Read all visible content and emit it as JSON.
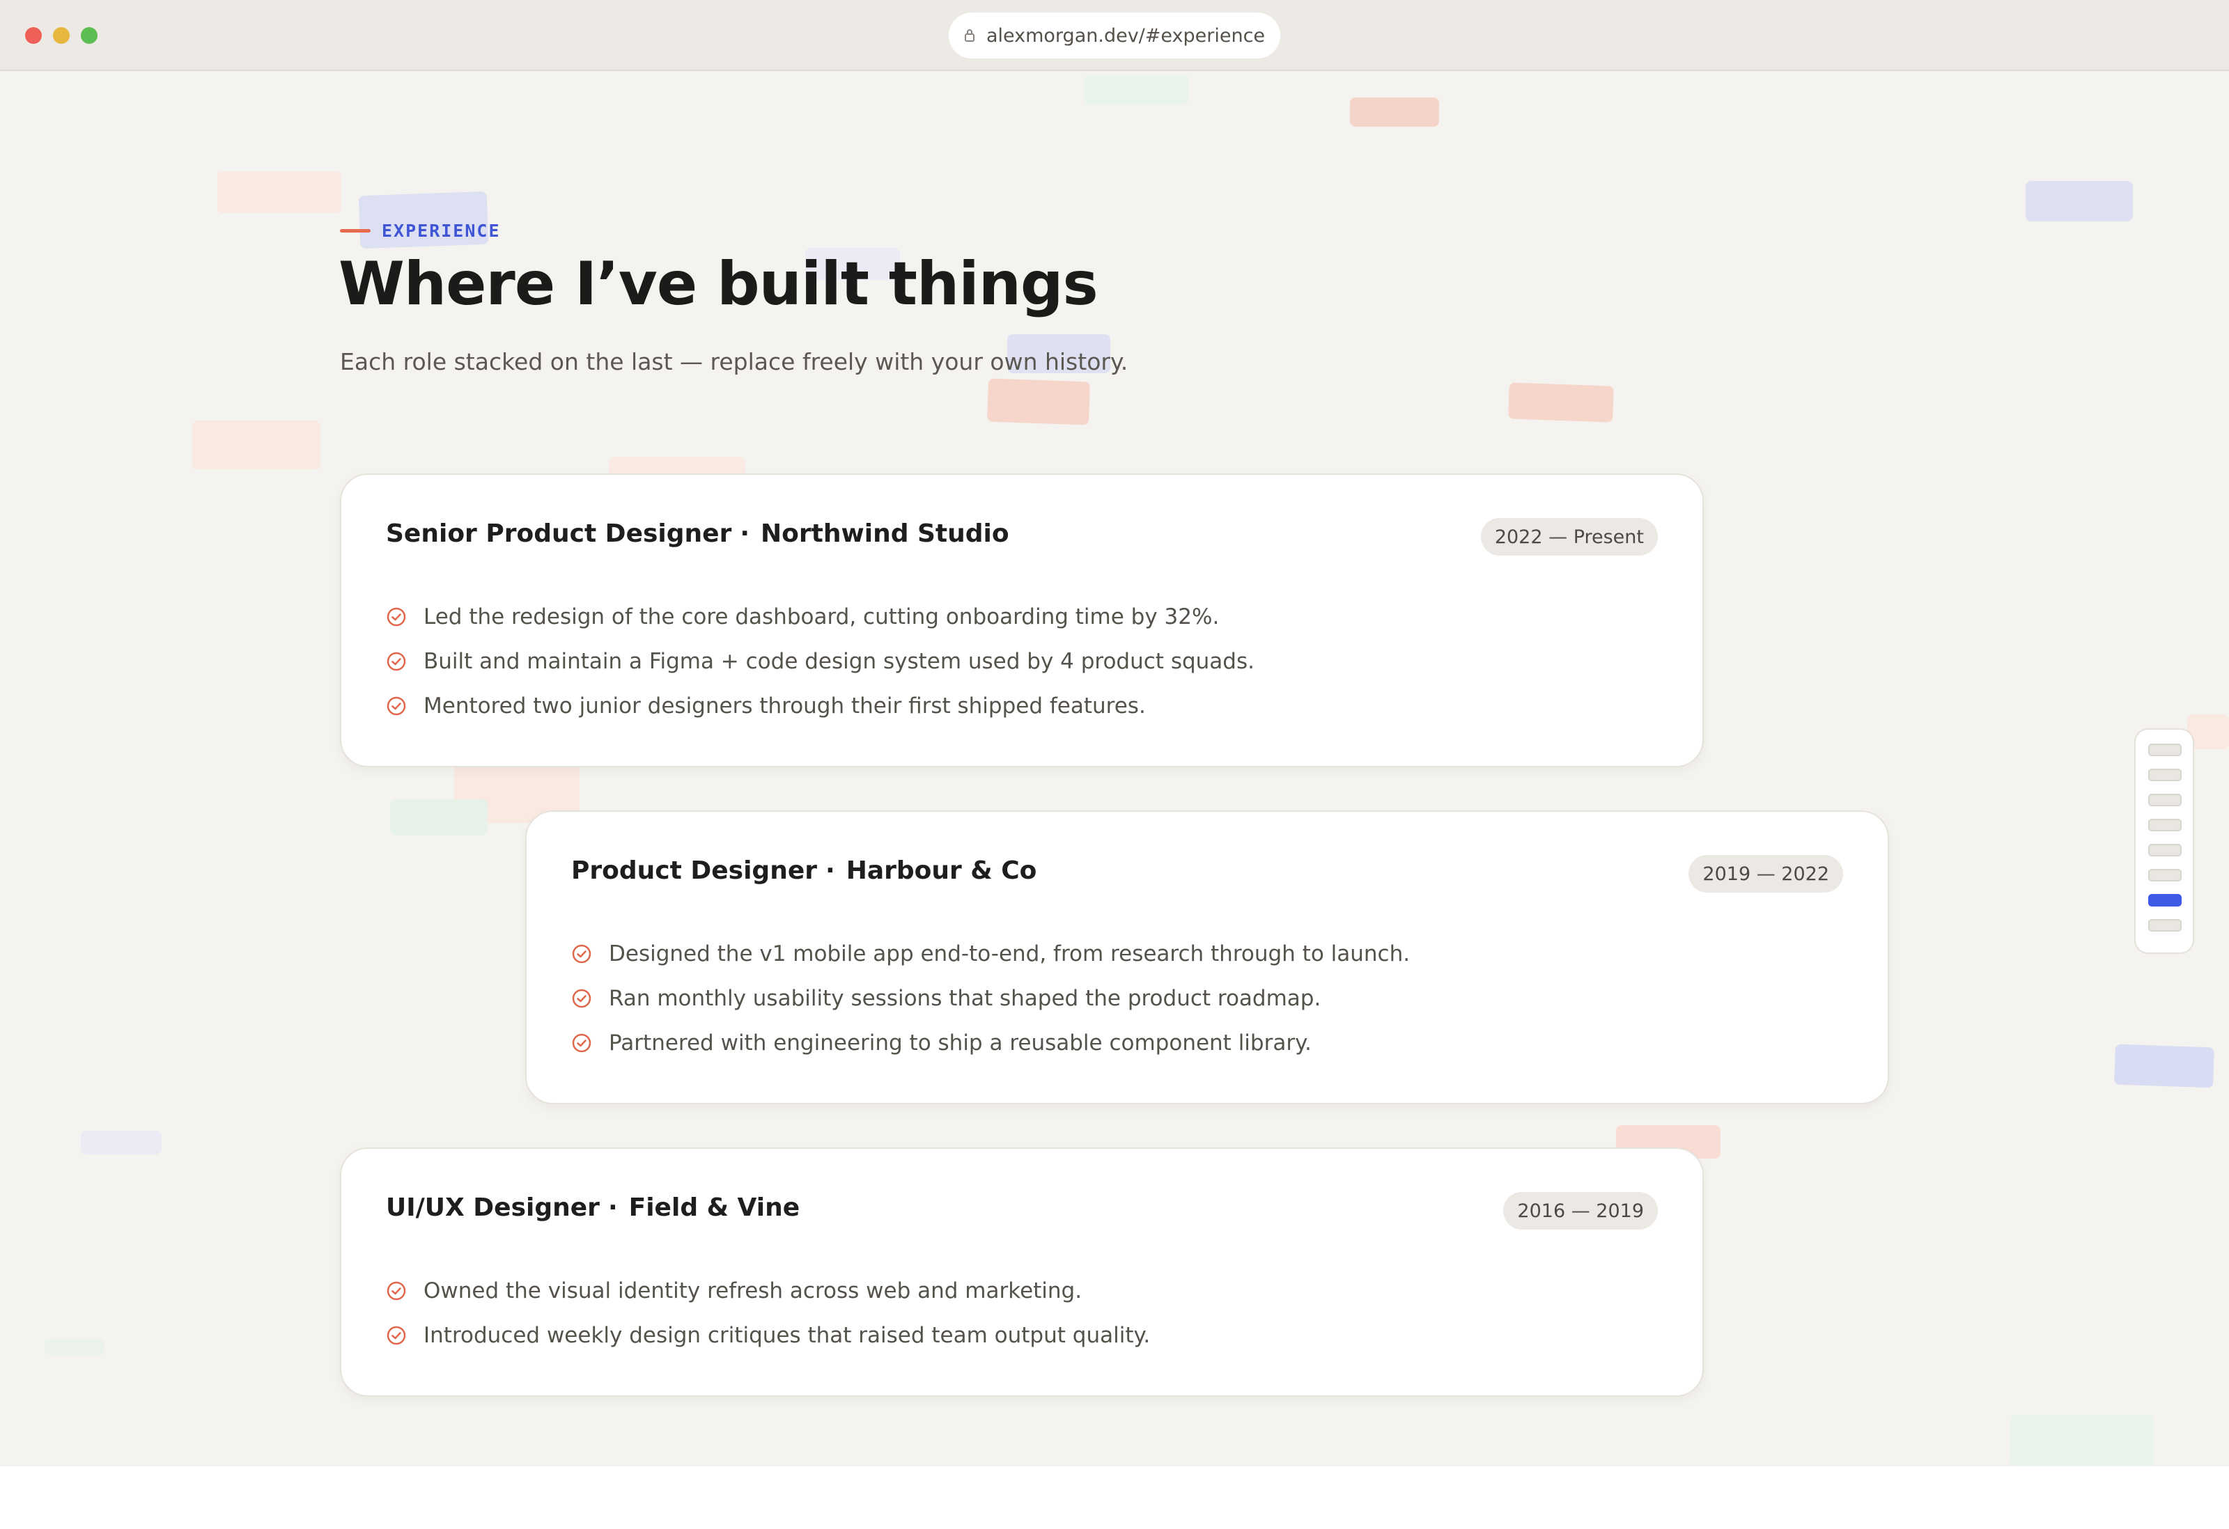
{
  "browser": {
    "url": "alexmorgan.dev/#experience"
  },
  "section": {
    "eyebrow": "EXPERIENCE",
    "title": "Where I’ve built things",
    "subtitle": "Each role stacked on the last — replace freely with your own history."
  },
  "roles": [
    {
      "title": "Senior Product Designer",
      "separator": "·",
      "company": "Northwind Studio",
      "dates": "2022 — Present",
      "bullets": [
        "Led the redesign of the core dashboard, cutting onboarding time by 32%.",
        "Built and maintain a Figma + code design system used by 4 product squads.",
        "Mentored two junior designers through their first shipped features."
      ]
    },
    {
      "title": "Product Designer",
      "separator": "·",
      "company": "Harbour & Co",
      "dates": "2019 — 2022",
      "bullets": [
        "Designed the v1 mobile app end-to-end, from research through to launch.",
        "Ran monthly usability sessions that shaped the product roadmap.",
        "Partnered with engineering to ship a reusable component library."
      ]
    },
    {
      "title": "UI/UX Designer",
      "separator": "·",
      "company": "Field & Vine",
      "dates": "2016 — 2019",
      "bullets": [
        "Owned the visual identity refresh across web and marketing.",
        "Introduced weekly design critiques that raised team output quality."
      ]
    }
  ],
  "section_nav": {
    "item_count": 8,
    "active_index": 6
  },
  "colors": {
    "accent_blue": "#3f5ae6",
    "accent_coral": "#e86a4c",
    "page_bg": "#f5f3ef"
  },
  "icons": {
    "lock": "lock-icon",
    "bullet": "check-circle-icon"
  }
}
